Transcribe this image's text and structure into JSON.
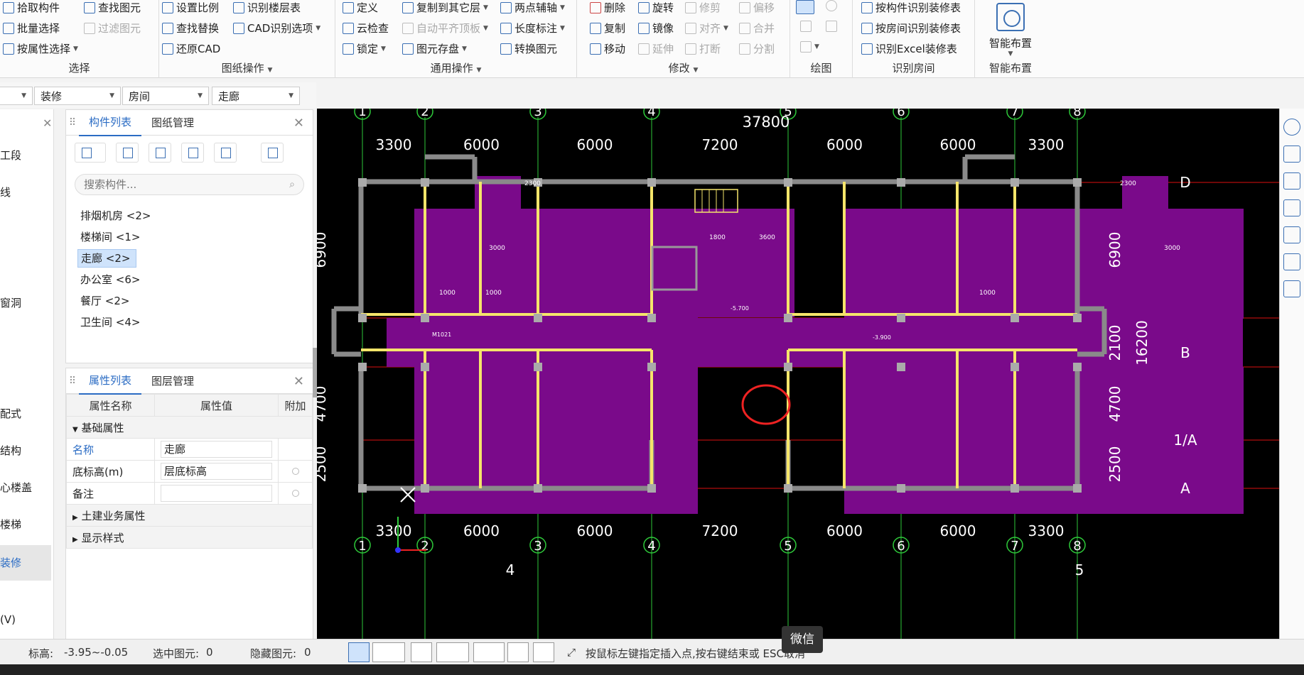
{
  "ribbon": {
    "select": {
      "title": "选择",
      "pick": "拾取构件",
      "batch": "批量选择",
      "by_attr": "按属性选择",
      "find": "查找图元",
      "filter": "过滤图元"
    },
    "drawing": {
      "title": "图纸操作",
      "scale": "设置比例",
      "find_replace": "查找替换",
      "restore": "还原CAD",
      "floors": "识别楼层表",
      "cad_opts": "CAD识别选项"
    },
    "common": {
      "title": "通用操作",
      "define": "定义",
      "cloud_check": "云检查",
      "lock": "锁定",
      "copy_other": "复制到其它层",
      "auto_align": "自动平齐顶板",
      "save_elem": "图元存盘",
      "two_pt": "两点辅轴",
      "len_mark": "长度标注",
      "convert": "转换图元"
    },
    "modify": {
      "title": "修改",
      "delete": "删除",
      "rotate": "旋转",
      "trim": "修剪",
      "offset": "偏移",
      "copy": "复制",
      "mirror": "镜像",
      "align": "对齐",
      "merge": "合并",
      "move": "移动",
      "extend": "延伸",
      "break": "打断",
      "split": "分割"
    },
    "draw": {
      "title": "绘图"
    },
    "recognize": {
      "title": "识别房间",
      "by_comp": "按构件识别装修表",
      "by_room": "按房间识别装修表",
      "excel": "识别Excel装修表"
    },
    "smart": {
      "title": "智能布置",
      "button": "智能布置"
    }
  },
  "filters": {
    "f1": "装修",
    "f2": "房间",
    "f3": "走廊"
  },
  "left_nav": {
    "items": [
      "工段",
      "线",
      "",
      "",
      "窗洞",
      "",
      "",
      "配式",
      "结构",
      "心楼盖",
      "楼梯",
      "装修",
      "(V)"
    ]
  },
  "comp_panel": {
    "tab1": "构件列表",
    "tab2": "图纸管理",
    "search_placeholder": "搜索构件...",
    "items": [
      "排烟机房 <2>",
      "楼梯间 <1>",
      "走廊 <2>",
      "办公室 <6>",
      "餐厅 <2>",
      "卫生间 <4>"
    ]
  },
  "prop_panel": {
    "tab1": "属性列表",
    "tab2": "图层管理",
    "col_name": "属性名称",
    "col_value": "属性值",
    "col_extra": "附加",
    "group_basic": "基础属性",
    "rows": [
      {
        "name": "名称",
        "value": "走廊"
      },
      {
        "name": "底标高(m)",
        "value": "层底标高"
      },
      {
        "name": "备注",
        "value": ""
      }
    ],
    "group_civil": "土建业务属性",
    "group_display": "显示样式"
  },
  "canvas": {
    "axes_top": [
      "1",
      "2",
      "3",
      "4",
      "5",
      "6",
      "7",
      "8"
    ],
    "total_dim": "37800",
    "spans": [
      "3300",
      "6000",
      "6000",
      "7200",
      "6000",
      "6000",
      "3300"
    ],
    "right_dims": [
      "6900",
      "2100",
      "4700",
      "2500"
    ],
    "right_total": "16200",
    "left_dims": [
      "6900",
      "4700",
      "2500"
    ],
    "row_axes": [
      "D",
      "B",
      "1/A",
      "A"
    ],
    "sample_dims": [
      "2300",
      "2300",
      "1800",
      "3600",
      "1000",
      "1000",
      "1000",
      "3000",
      "3000"
    ],
    "label_m1021": "M1021",
    "bottom_marks": [
      "4",
      "5"
    ],
    "elev_1": "-5.700",
    "elev_2": "-3.900"
  },
  "status": {
    "elev_label": "标高:",
    "elev_value": "-3.95~-0.05",
    "sel_label": "选中图元:",
    "sel_value": "0",
    "hid_label": "隐藏图元:",
    "hid_value": "0",
    "hint": "按鼠标左键指定插入点,按右键结束或 ESC取消"
  },
  "tooltip": "微信",
  "colors": {
    "wall": "#8a8a8a",
    "room_fill": "#7a0a8a",
    "beam": "#f5e56a",
    "axis": "#d11",
    "grid_green": "#2ec93a",
    "dim": "#ffffff",
    "highlight": "#e22"
  }
}
